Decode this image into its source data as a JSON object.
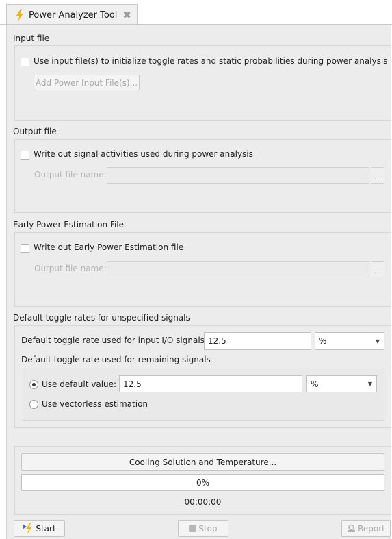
{
  "tab": {
    "title": "Power Analyzer Tool",
    "icon": "lightning-bolt-icon",
    "close_icon": "close-icon"
  },
  "input_file": {
    "section_title": "Input file",
    "checkbox_label": "Use input file(s) to initialize toggle rates and static probabilities during power analysis",
    "checked": false,
    "add_button_label": "Add Power Input File(s)..."
  },
  "output_file": {
    "section_title": "Output file",
    "checkbox_label": "Write out signal activities used during power analysis",
    "checked": false,
    "field_label": "Output file name:",
    "field_value": "",
    "browse_label": "..."
  },
  "early_power": {
    "section_title": "Early Power Estimation File",
    "checkbox_label": "Write out Early Power Estimation file",
    "checked": false,
    "field_label": "Output file name:",
    "field_value": "",
    "browse_label": "..."
  },
  "toggle_rates": {
    "section_title": "Default toggle rates for unspecified signals",
    "input_io_label": "Default toggle rate used for input I/O signals:",
    "input_io_value": "12.5",
    "input_io_unit": "%",
    "remaining_label": "Default toggle rate used for remaining signals",
    "use_default_label": "Use default value:",
    "use_default_selected": true,
    "default_value": "12.5",
    "default_unit": "%",
    "vectorless_label": "Use vectorless estimation",
    "vectorless_selected": false
  },
  "status": {
    "cooling_button_label": "Cooling Solution and Temperature...",
    "progress_text": "0%",
    "progress_fraction": 0,
    "elapsed_time": "00:00:00"
  },
  "actions": {
    "start_label": "Start",
    "stop_label": "Stop",
    "report_label": "Report",
    "colors": {
      "accent": "#f5b400",
      "start_arrow": "#2f6fd6"
    }
  }
}
